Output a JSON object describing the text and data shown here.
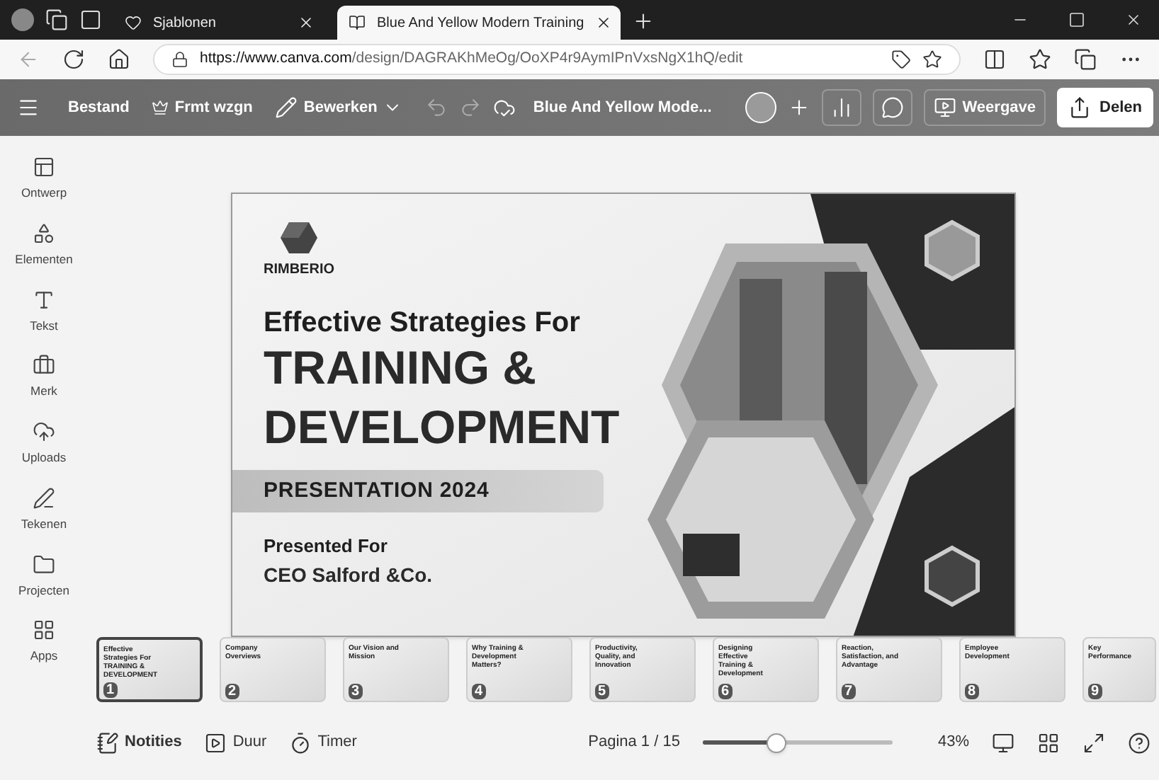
{
  "browser": {
    "tabs": [
      {
        "title": "Sjablonen",
        "selected": false
      },
      {
        "title": "Blue And Yellow Modern Training",
        "selected": true
      }
    ],
    "url_host": "https://www.canva.com",
    "url_path": "/design/DAGRAKhMeOg/OoXP4r9AymIPnVxsNgX1hQ/edit"
  },
  "toolbar": {
    "menu": [
      "Bestand",
      "Frmt wzgn",
      "Bewerken"
    ],
    "design_title": "Blue And Yellow Mode...",
    "view_button": "Weergave",
    "share_button": "Delen"
  },
  "sidebar": {
    "items": [
      {
        "label": "Ontwerp"
      },
      {
        "label": "Elementen"
      },
      {
        "label": "Tekst"
      },
      {
        "label": "Merk"
      },
      {
        "label": "Uploads"
      },
      {
        "label": "Tekenen"
      },
      {
        "label": "Projecten"
      },
      {
        "label": "Apps"
      }
    ]
  },
  "slide": {
    "brand": "RIMBERIO",
    "subtitle": "Effective Strategies For",
    "title_lines": [
      "TRAINING &",
      "DEVELOPMENT"
    ],
    "banner": "PRESENTATION 2024",
    "presented_label": "Presented For",
    "client": "CEO Salford &Co."
  },
  "thumbnails": [
    {
      "number": "1",
      "title": "Effective Strategies For TRAINING & DEVELOPMENT",
      "selected": true
    },
    {
      "number": "2",
      "title": "Company Overviews",
      "selected": false
    },
    {
      "number": "3",
      "title": "Our Vision and Mission",
      "selected": false
    },
    {
      "number": "4",
      "title": "Why Training & Development Matters?",
      "selected": false
    },
    {
      "number": "5",
      "title": "Productivity, Quality, and Innovation",
      "selected": false
    },
    {
      "number": "6",
      "title": "Designing Effective Training & Development",
      "selected": false
    },
    {
      "number": "7",
      "title": "Reaction, Satisfaction, and Advantage",
      "selected": false
    },
    {
      "number": "8",
      "title": "Employee Development",
      "selected": false
    },
    {
      "number": "9",
      "title": "Key Performance",
      "selected": false
    }
  ],
  "footer": {
    "notes": "Notities",
    "duration": "Duur",
    "timer": "Timer",
    "page": "Pagina 1 / 15",
    "zoom": {
      "level": 0.39,
      "reading": "43%"
    }
  }
}
